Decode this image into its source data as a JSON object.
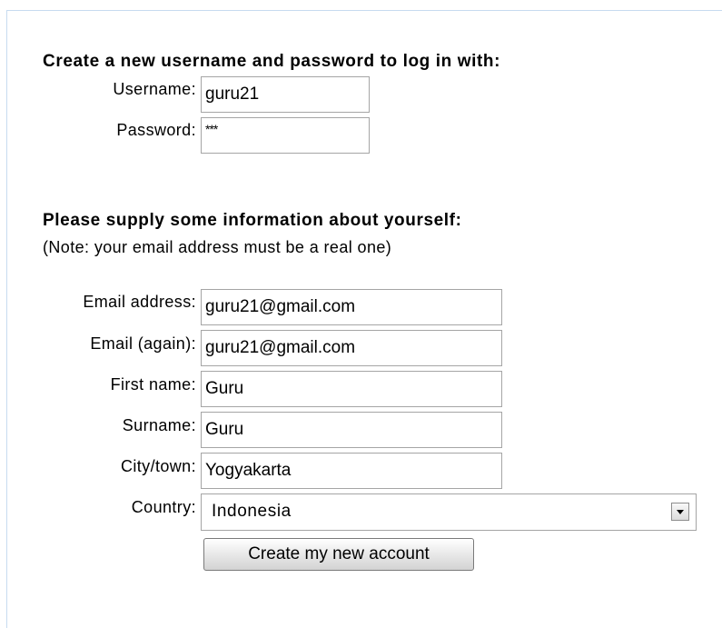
{
  "login_section": {
    "heading": "Create a new username and password to log in with:",
    "username_label": "Username:",
    "username_value": "guru21",
    "password_label": "Password:",
    "password_value": "***"
  },
  "info_section": {
    "heading": "Please supply some information about yourself:",
    "note": "(Note: your email address must be a real one)",
    "email_label": "Email address:",
    "email_value": "guru21@gmail.com",
    "email_again_label": "Email (again):",
    "email_again_value": "guru21@gmail.com",
    "first_name_label": "First name:",
    "first_name_value": "Guru",
    "surname_label": "Surname:",
    "surname_value": "Guru",
    "city_label": "City/town:",
    "city_value": "Yogyakarta",
    "country_label": "Country:",
    "country_value": "Indonesia"
  },
  "submit_label": "Create my new account"
}
